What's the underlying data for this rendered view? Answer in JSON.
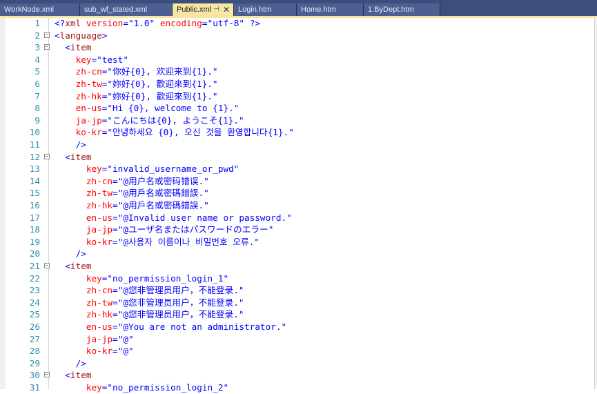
{
  "tabs": [
    {
      "label": "WorkNode.xml",
      "active": false
    },
    {
      "label": "sub_wf_stated.xml",
      "active": false
    },
    {
      "label": "Public.xml",
      "active": true
    },
    {
      "label": "Login.htm",
      "active": false
    },
    {
      "label": "Home.htm",
      "active": false
    },
    {
      "label": "1.ByDept.htm",
      "active": false
    }
  ],
  "tab_icons": {
    "pin": "pin-icon",
    "close": "close-icon"
  },
  "colors": {
    "tag": "#a31515",
    "bracket": "#0000ff",
    "attribute": "#ff0000",
    "value": "#0000ff",
    "line_number": "#2b91af",
    "tab_active": "#f5e6a3",
    "tab_bar": "#3c4e7c"
  },
  "editor": {
    "lines": [
      {
        "num": "1",
        "fold": "",
        "indent": "",
        "tokens": [
          [
            "br",
            "<?"
          ],
          [
            "tag",
            "xml"
          ],
          [
            "sp",
            " "
          ],
          [
            "attr",
            "version"
          ],
          [
            "eq",
            "="
          ],
          [
            "val",
            "\"1.0\""
          ],
          [
            "sp",
            " "
          ],
          [
            "attr",
            "encoding"
          ],
          [
            "eq",
            "="
          ],
          [
            "val",
            "\"utf-8\""
          ],
          [
            "sp",
            " "
          ],
          [
            "br",
            "?>"
          ]
        ]
      },
      {
        "num": "2",
        "fold": "−",
        "indent": "",
        "tokens": [
          [
            "br",
            "<"
          ],
          [
            "tag",
            "language"
          ],
          [
            "br",
            ">"
          ]
        ]
      },
      {
        "num": "3",
        "fold": "−",
        "indent": "  ",
        "tokens": [
          [
            "br",
            "<"
          ],
          [
            "tag",
            "item"
          ]
        ]
      },
      {
        "num": "4",
        "fold": "",
        "indent": "    ",
        "tokens": [
          [
            "attr",
            "key"
          ],
          [
            "eq",
            "="
          ],
          [
            "val",
            "\"test\""
          ]
        ]
      },
      {
        "num": "5",
        "fold": "",
        "indent": "    ",
        "tokens": [
          [
            "attr",
            "zh-cn"
          ],
          [
            "eq",
            "="
          ],
          [
            "val",
            "\"你好{0}, 欢迎来到{1}.\""
          ]
        ]
      },
      {
        "num": "6",
        "fold": "",
        "indent": "    ",
        "tokens": [
          [
            "attr",
            "zh-tw"
          ],
          [
            "eq",
            "="
          ],
          [
            "val",
            "\"妳好{0}, 歡迎來到{1}.\""
          ]
        ]
      },
      {
        "num": "7",
        "fold": "",
        "indent": "    ",
        "tokens": [
          [
            "attr",
            "zh-hk"
          ],
          [
            "eq",
            "="
          ],
          [
            "val",
            "\"妳好{0}, 歡迎來到{1}.\""
          ]
        ]
      },
      {
        "num": "8",
        "fold": "",
        "indent": "    ",
        "tokens": [
          [
            "attr",
            "en-us"
          ],
          [
            "eq",
            "="
          ],
          [
            "val",
            "\"Hi {0}, welcome to {1}.\""
          ]
        ]
      },
      {
        "num": "9",
        "fold": "",
        "indent": "    ",
        "tokens": [
          [
            "attr",
            "ja-jp"
          ],
          [
            "eq",
            "="
          ],
          [
            "val",
            "\"こんにちは{0}, ようこそ{1}.\""
          ]
        ]
      },
      {
        "num": "10",
        "fold": "",
        "indent": "    ",
        "tokens": [
          [
            "attr",
            "ko-kr"
          ],
          [
            "eq",
            "="
          ],
          [
            "val",
            "\"안녕하세요 {0}, 오신 것을 환영합니다{1}.\""
          ]
        ]
      },
      {
        "num": "11",
        "fold": "",
        "indent": "    ",
        "tokens": [
          [
            "br",
            "/>"
          ]
        ]
      },
      {
        "num": "12",
        "fold": "−",
        "indent": "  ",
        "tokens": [
          [
            "br",
            "<"
          ],
          [
            "tag",
            "item"
          ]
        ]
      },
      {
        "num": "13",
        "fold": "",
        "indent": "      ",
        "tokens": [
          [
            "attr",
            "key"
          ],
          [
            "eq",
            "="
          ],
          [
            "val",
            "\"invalid_username_or_pwd\""
          ]
        ]
      },
      {
        "num": "14",
        "fold": "",
        "indent": "      ",
        "tokens": [
          [
            "attr",
            "zh-cn"
          ],
          [
            "eq",
            "="
          ],
          [
            "val",
            "\"@用户名或密码错误.\""
          ]
        ]
      },
      {
        "num": "15",
        "fold": "",
        "indent": "      ",
        "tokens": [
          [
            "attr",
            "zh-tw"
          ],
          [
            "eq",
            "="
          ],
          [
            "val",
            "\"@用戶名或密碼錯誤.\""
          ]
        ]
      },
      {
        "num": "16",
        "fold": "",
        "indent": "      ",
        "tokens": [
          [
            "attr",
            "zh-hk"
          ],
          [
            "eq",
            "="
          ],
          [
            "val",
            "\"@用戶名或密碼錯誤.\""
          ]
        ]
      },
      {
        "num": "17",
        "fold": "",
        "indent": "      ",
        "tokens": [
          [
            "attr",
            "en-us"
          ],
          [
            "eq",
            "="
          ],
          [
            "val",
            "\"@Invalid user name or password.\""
          ]
        ]
      },
      {
        "num": "18",
        "fold": "",
        "indent": "      ",
        "tokens": [
          [
            "attr",
            "ja-jp"
          ],
          [
            "eq",
            "="
          ],
          [
            "val",
            "\"@ユーザ名またはパスワードのエラー\""
          ]
        ]
      },
      {
        "num": "19",
        "fold": "",
        "indent": "      ",
        "tokens": [
          [
            "attr",
            "ko-kr"
          ],
          [
            "eq",
            "="
          ],
          [
            "val",
            "\"@사용자 이름이나 비밀번호 오류.\""
          ]
        ]
      },
      {
        "num": "20",
        "fold": "",
        "indent": "    ",
        "tokens": [
          [
            "br",
            "/>"
          ]
        ]
      },
      {
        "num": "21",
        "fold": "−",
        "indent": "  ",
        "tokens": [
          [
            "br",
            "<"
          ],
          [
            "tag",
            "item"
          ]
        ]
      },
      {
        "num": "22",
        "fold": "",
        "indent": "      ",
        "tokens": [
          [
            "attr",
            "key"
          ],
          [
            "eq",
            "="
          ],
          [
            "val",
            "\"no_permission_login_1\""
          ]
        ]
      },
      {
        "num": "23",
        "fold": "",
        "indent": "      ",
        "tokens": [
          [
            "attr",
            "zh-cn"
          ],
          [
            "eq",
            "="
          ],
          [
            "val",
            "\"@您非管理员用户，不能登录.\""
          ]
        ]
      },
      {
        "num": "24",
        "fold": "",
        "indent": "      ",
        "tokens": [
          [
            "attr",
            "zh-tw"
          ],
          [
            "eq",
            "="
          ],
          [
            "val",
            "\"@您非管理员用户，不能登录.\""
          ]
        ]
      },
      {
        "num": "25",
        "fold": "",
        "indent": "      ",
        "tokens": [
          [
            "attr",
            "zh-hk"
          ],
          [
            "eq",
            "="
          ],
          [
            "val",
            "\"@您非管理员用户，不能登录.\""
          ]
        ]
      },
      {
        "num": "26",
        "fold": "",
        "indent": "      ",
        "tokens": [
          [
            "attr",
            "en-us"
          ],
          [
            "eq",
            "="
          ],
          [
            "val",
            "\"@You are not an administrator.\""
          ]
        ]
      },
      {
        "num": "27",
        "fold": "",
        "indent": "      ",
        "tokens": [
          [
            "attr",
            "ja-jp"
          ],
          [
            "eq",
            "="
          ],
          [
            "val",
            "\"@\""
          ]
        ]
      },
      {
        "num": "28",
        "fold": "",
        "indent": "      ",
        "tokens": [
          [
            "attr",
            "ko-kr"
          ],
          [
            "eq",
            "="
          ],
          [
            "val",
            "\"@\""
          ]
        ]
      },
      {
        "num": "29",
        "fold": "",
        "indent": "    ",
        "tokens": [
          [
            "br",
            "/>"
          ]
        ]
      },
      {
        "num": "30",
        "fold": "−",
        "indent": "  ",
        "tokens": [
          [
            "br",
            "<"
          ],
          [
            "tag",
            "item"
          ]
        ]
      },
      {
        "num": "31",
        "fold": "",
        "indent": "      ",
        "tokens": [
          [
            "attr",
            "key"
          ],
          [
            "eq",
            "="
          ],
          [
            "val",
            "\"no_permission_login_2\""
          ]
        ]
      }
    ]
  }
}
